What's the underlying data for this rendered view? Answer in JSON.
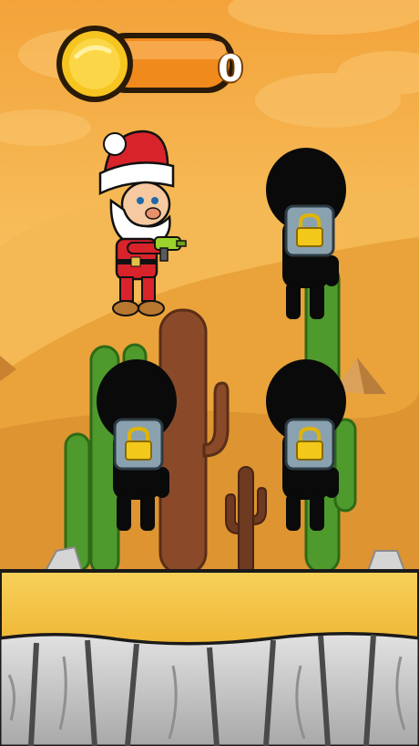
{
  "hud": {
    "coin_count": "0",
    "coin_icon": "gold-coin-icon"
  },
  "characters": [
    {
      "id": "santa",
      "state": "selected",
      "icon": "santa-player-icon"
    },
    {
      "id": "slot-2",
      "state": "locked",
      "icon": "padlock-icon"
    },
    {
      "id": "slot-3",
      "state": "locked",
      "icon": "padlock-icon"
    },
    {
      "id": "slot-4",
      "state": "locked",
      "icon": "padlock-icon"
    }
  ],
  "colors": {
    "sky_top": "#f3a33a",
    "sky_bottom": "#f7c25b",
    "dune": "#e8a236",
    "sand": "#f2c23e",
    "rock": "#cfcfcf",
    "coin_gold": "#f7c520",
    "hud_orange": "#f08a1c",
    "silhouette": "#0a0a0a",
    "lock_panel": "#8aa2b0",
    "cactus_green": "#4f9a2d",
    "cactus_brown": "#8a4a2a"
  }
}
